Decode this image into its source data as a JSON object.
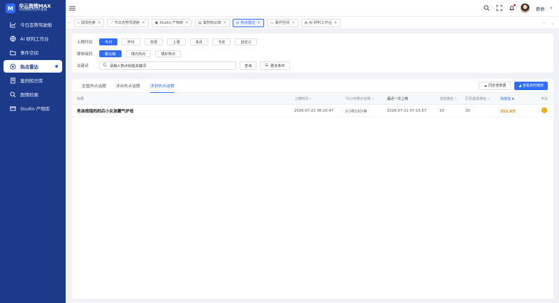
{
  "brand": {
    "logo_letter": "M",
    "title": "华云舆情MAX",
    "subtitle": "AI舆情研判分析系统"
  },
  "sidebar": {
    "items": [
      {
        "label": "今日态势驾驶舱",
        "icon": "trend-icon"
      },
      {
        "label": "AI 研判工作台",
        "icon": "globe-icon"
      },
      {
        "label": "事件空间",
        "icon": "folder-icon"
      },
      {
        "label": "热点雷达",
        "icon": "radar-icon",
        "active": true
      },
      {
        "label": "案例知识库",
        "icon": "book-icon"
      },
      {
        "label": "舆情检索",
        "icon": "search-icon"
      },
      {
        "label": "Studio 产物库",
        "icon": "box-icon"
      }
    ]
  },
  "topbar": {
    "username": "君依"
  },
  "tabs": [
    {
      "label": "舆情检索",
      "icon": "search-icon"
    },
    {
      "label": "今日态势驾驶舱",
      "icon": "trend-icon"
    },
    {
      "label": "Studio 产物库",
      "icon": "box-icon"
    },
    {
      "label": "案例知识库",
      "icon": "book-icon"
    },
    {
      "label": "热点雷达",
      "icon": "radar-icon",
      "active": true
    },
    {
      "label": "事件空间",
      "icon": "folder-icon"
    },
    {
      "label": "AI 研判工作台",
      "icon": "globe-icon"
    }
  ],
  "filters": {
    "time_label": "上榜时间",
    "time_options": [
      "今日",
      "昨日",
      "本周",
      "上周",
      "本月",
      "今年",
      "自定义"
    ],
    "level_label": "媒体级别",
    "level_options": [
      "聚合榜",
      "境内热点",
      "境外热点"
    ],
    "keyword_label": "关键词",
    "keyword_placeholder": "请输入热点标题关键词",
    "query_button": "查询",
    "more_button": "更多条件"
  },
  "subtabs": [
    "全国热点话题",
    "涉台热点话题",
    "涉浙热点话题"
  ],
  "actions": {
    "sync": "同步老数据",
    "realtime": "查看实时榜单"
  },
  "table": {
    "headers": [
      "标题",
      "上榜时间",
      "72小时累计在榜",
      "最近一次上榜",
      "当前排名",
      "历史最高排名",
      "热度值",
      "平台"
    ],
    "rows": [
      {
        "title": "男孩抱错妈妈后小女孩霸气护母",
        "time": "2026-07-21 06:20:47",
        "duration": "2小时19分钟",
        "last": "2026-07-21 07:15:57",
        "rank": "20",
        "best": "20",
        "heat": "211.9万"
      }
    ]
  },
  "colors": {
    "sidebar": "#1d3a8a",
    "accent": "#2f6df6",
    "heat": "#e67a00"
  }
}
